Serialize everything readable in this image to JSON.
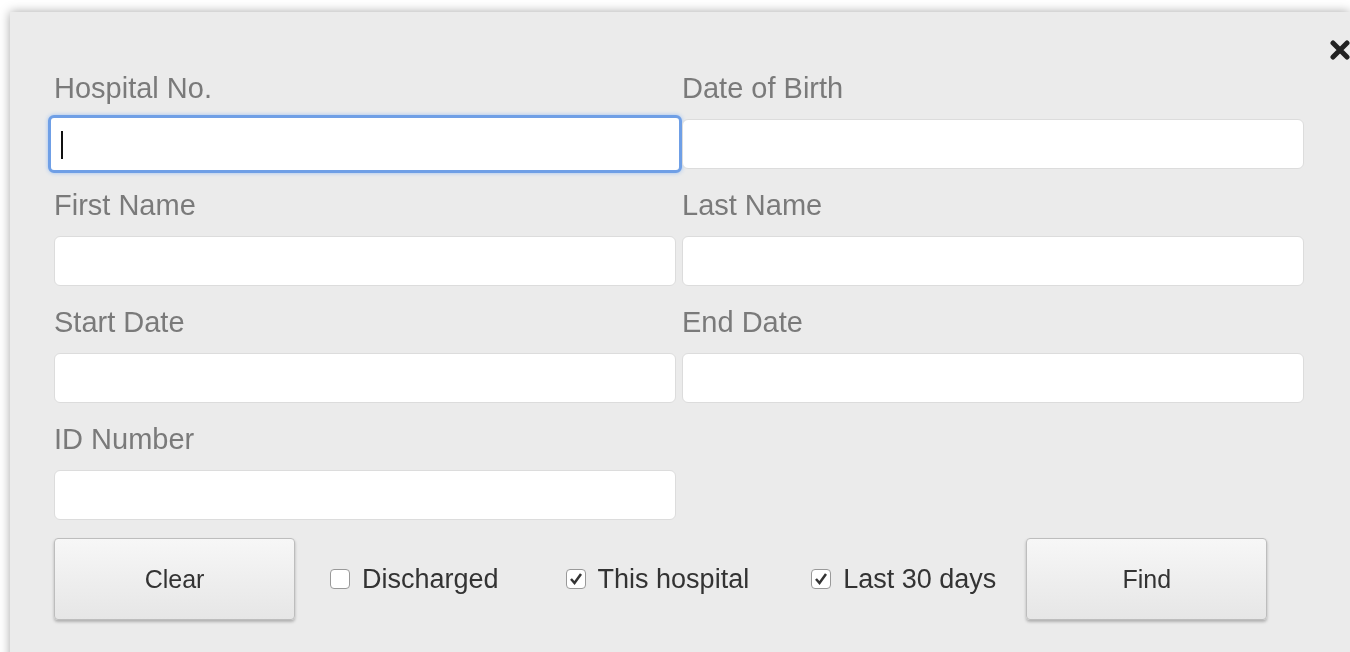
{
  "fields": [
    {
      "label": "Hospital No.",
      "focused": true
    },
    {
      "label": "Date of Birth",
      "focused": false
    },
    {
      "label": "First Name",
      "focused": false
    },
    {
      "label": "Last Name",
      "focused": false
    },
    {
      "label": "Start Date",
      "focused": false
    },
    {
      "label": "End Date",
      "focused": false
    },
    {
      "label": "ID Number",
      "focused": false
    }
  ],
  "options": [
    {
      "label": "Discharged",
      "checked": false
    },
    {
      "label": "This hospital",
      "checked": true
    },
    {
      "label": "Last 30 days",
      "checked": true
    }
  ],
  "buttons": {
    "clear": "Clear",
    "find": "Find"
  }
}
